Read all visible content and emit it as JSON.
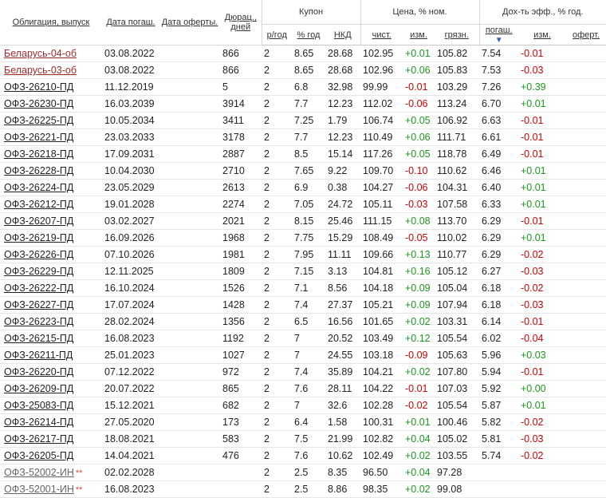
{
  "headers": {
    "bond": "Облигация, выпуск",
    "maturity_date": "Дата погаш.",
    "offer_date": "Дата оферты.",
    "duration": "Дюрац., дней",
    "coupon_group": "Купон",
    "price_group": "Цена, % ном.",
    "yield_group": "Дох-ть эфф., % год.",
    "coupon_freq": "р/год",
    "coupon_pct": "% год",
    "nkd": "НКД",
    "clean": "чист.",
    "change": "изм.",
    "dirty": "грязн.",
    "yield_maturity": "погаш.",
    "yield_change": "изм.",
    "yield_offer": "оферт."
  },
  "rows": [
    {
      "name": "Беларусь-04-об",
      "style": "red",
      "stars": "",
      "mat": "03.08.2022",
      "offer": "",
      "dur": "866",
      "freq": "2",
      "cpn": "8.65",
      "nkd": "28.68",
      "clean": "102.95",
      "chg": "+0.01",
      "dirty": "105.82",
      "ym": "7.54",
      "ychg": "-0.01",
      "yoff": ""
    },
    {
      "name": "Беларусь-03-об",
      "style": "red",
      "stars": "",
      "mat": "03.08.2022",
      "offer": "",
      "dur": "866",
      "freq": "2",
      "cpn": "8.65",
      "nkd": "28.68",
      "clean": "102.96",
      "chg": "+0.06",
      "dirty": "105.83",
      "ym": "7.53",
      "ychg": "-0.03",
      "yoff": ""
    },
    {
      "name": "ОФЗ-26210-ПД",
      "style": "",
      "stars": "",
      "mat": "11.12.2019",
      "offer": "",
      "dur": "5",
      "freq": "2",
      "cpn": "6.8",
      "nkd": "32.98",
      "clean": "99.99",
      "chg": "-0.01",
      "dirty": "103.29",
      "ym": "7.26",
      "ychg": "+0.39",
      "yoff": ""
    },
    {
      "name": "ОФЗ-26230-ПД",
      "style": "",
      "stars": "",
      "mat": "16.03.2039",
      "offer": "",
      "dur": "3914",
      "freq": "2",
      "cpn": "7.7",
      "nkd": "12.23",
      "clean": "112.02",
      "chg": "-0.06",
      "dirty": "113.24",
      "ym": "6.70",
      "ychg": "+0.01",
      "yoff": ""
    },
    {
      "name": "ОФЗ-26225-ПД",
      "style": "",
      "stars": "",
      "mat": "10.05.2034",
      "offer": "",
      "dur": "3411",
      "freq": "2",
      "cpn": "7.25",
      "nkd": "1.79",
      "clean": "106.74",
      "chg": "+0.05",
      "dirty": "106.92",
      "ym": "6.63",
      "ychg": "-0.01",
      "yoff": ""
    },
    {
      "name": "ОФЗ-26221-ПД",
      "style": "",
      "stars": "",
      "mat": "23.03.2033",
      "offer": "",
      "dur": "3178",
      "freq": "2",
      "cpn": "7.7",
      "nkd": "12.23",
      "clean": "110.49",
      "chg": "+0.06",
      "dirty": "111.71",
      "ym": "6.61",
      "ychg": "-0.01",
      "yoff": ""
    },
    {
      "name": "ОФЗ-26218-ПД",
      "style": "",
      "stars": "",
      "mat": "17.09.2031",
      "offer": "",
      "dur": "2887",
      "freq": "2",
      "cpn": "8.5",
      "nkd": "15.14",
      "clean": "117.26",
      "chg": "+0.05",
      "dirty": "118.78",
      "ym": "6.49",
      "ychg": "-0.01",
      "yoff": ""
    },
    {
      "name": "ОФЗ-26228-ПД",
      "style": "",
      "stars": "",
      "mat": "10.04.2030",
      "offer": "",
      "dur": "2710",
      "freq": "2",
      "cpn": "7.65",
      "nkd": "9.22",
      "clean": "109.70",
      "chg": "-0.10",
      "dirty": "110.62",
      "ym": "6.46",
      "ychg": "+0.01",
      "yoff": ""
    },
    {
      "name": "ОФЗ-26224-ПД",
      "style": "",
      "stars": "",
      "mat": "23.05.2029",
      "offer": "",
      "dur": "2613",
      "freq": "2",
      "cpn": "6.9",
      "nkd": "0.38",
      "clean": "104.27",
      "chg": "-0.06",
      "dirty": "104.31",
      "ym": "6.40",
      "ychg": "+0.01",
      "yoff": ""
    },
    {
      "name": "ОФЗ-26212-ПД",
      "style": "",
      "stars": "",
      "mat": "19.01.2028",
      "offer": "",
      "dur": "2274",
      "freq": "2",
      "cpn": "7.05",
      "nkd": "24.72",
      "clean": "105.11",
      "chg": "-0.03",
      "dirty": "107.58",
      "ym": "6.33",
      "ychg": "+0.01",
      "yoff": ""
    },
    {
      "name": "ОФЗ-26207-ПД",
      "style": "",
      "stars": "",
      "mat": "03.02.2027",
      "offer": "",
      "dur": "2021",
      "freq": "2",
      "cpn": "8.15",
      "nkd": "25.46",
      "clean": "111.15",
      "chg": "+0.08",
      "dirty": "113.70",
      "ym": "6.29",
      "ychg": "-0.01",
      "yoff": ""
    },
    {
      "name": "ОФЗ-26219-ПД",
      "style": "",
      "stars": "",
      "mat": "16.09.2026",
      "offer": "",
      "dur": "1968",
      "freq": "2",
      "cpn": "7.75",
      "nkd": "15.29",
      "clean": "108.49",
      "chg": "-0.05",
      "dirty": "110.02",
      "ym": "6.29",
      "ychg": "+0.01",
      "yoff": ""
    },
    {
      "name": "ОФЗ-26226-ПД",
      "style": "",
      "stars": "",
      "mat": "07.10.2026",
      "offer": "",
      "dur": "1981",
      "freq": "2",
      "cpn": "7.95",
      "nkd": "11.11",
      "clean": "109.66",
      "chg": "+0.13",
      "dirty": "110.77",
      "ym": "6.29",
      "ychg": "-0.02",
      "yoff": ""
    },
    {
      "name": "ОФЗ-26229-ПД",
      "style": "",
      "stars": "",
      "mat": "12.11.2025",
      "offer": "",
      "dur": "1809",
      "freq": "2",
      "cpn": "7.15",
      "nkd": "3.13",
      "clean": "104.81",
      "chg": "+0.16",
      "dirty": "105.12",
      "ym": "6.27",
      "ychg": "-0.03",
      "yoff": ""
    },
    {
      "name": "ОФЗ-26222-ПД",
      "style": "",
      "stars": "",
      "mat": "16.10.2024",
      "offer": "",
      "dur": "1526",
      "freq": "2",
      "cpn": "7.1",
      "nkd": "8.56",
      "clean": "104.18",
      "chg": "+0.09",
      "dirty": "105.04",
      "ym": "6.18",
      "ychg": "-0.02",
      "yoff": ""
    },
    {
      "name": "ОФЗ-26227-ПД",
      "style": "",
      "stars": "",
      "mat": "17.07.2024",
      "offer": "",
      "dur": "1428",
      "freq": "2",
      "cpn": "7.4",
      "nkd": "27.37",
      "clean": "105.21",
      "chg": "+0.09",
      "dirty": "107.94",
      "ym": "6.18",
      "ychg": "-0.03",
      "yoff": ""
    },
    {
      "name": "ОФЗ-26223-ПД",
      "style": "",
      "stars": "",
      "mat": "28.02.2024",
      "offer": "",
      "dur": "1356",
      "freq": "2",
      "cpn": "6.5",
      "nkd": "16.56",
      "clean": "101.65",
      "chg": "+0.02",
      "dirty": "103.31",
      "ym": "6.14",
      "ychg": "-0.01",
      "yoff": ""
    },
    {
      "name": "ОФЗ-26215-ПД",
      "style": "",
      "stars": "",
      "mat": "16.08.2023",
      "offer": "",
      "dur": "1192",
      "freq": "2",
      "cpn": "7",
      "nkd": "20.52",
      "clean": "103.49",
      "chg": "+0.12",
      "dirty": "105.54",
      "ym": "6.02",
      "ychg": "-0.04",
      "yoff": ""
    },
    {
      "name": "ОФЗ-26211-ПД",
      "style": "",
      "stars": "",
      "mat": "25.01.2023",
      "offer": "",
      "dur": "1027",
      "freq": "2",
      "cpn": "7",
      "nkd": "24.55",
      "clean": "103.18",
      "chg": "-0.09",
      "dirty": "105.63",
      "ym": "5.96",
      "ychg": "+0.03",
      "yoff": ""
    },
    {
      "name": "ОФЗ-26220-ПД",
      "style": "",
      "stars": "",
      "mat": "07.12.2022",
      "offer": "",
      "dur": "972",
      "freq": "2",
      "cpn": "7.4",
      "nkd": "35.89",
      "clean": "104.21",
      "chg": "+0.02",
      "dirty": "107.80",
      "ym": "5.94",
      "ychg": "-0.01",
      "yoff": ""
    },
    {
      "name": "ОФЗ-26209-ПД",
      "style": "",
      "stars": "",
      "mat": "20.07.2022",
      "offer": "",
      "dur": "865",
      "freq": "2",
      "cpn": "7.6",
      "nkd": "28.11",
      "clean": "104.22",
      "chg": "-0.01",
      "dirty": "107.03",
      "ym": "5.92",
      "ychg": "+0.00",
      "yoff": ""
    },
    {
      "name": "ОФЗ-25083-ПД",
      "style": "",
      "stars": "",
      "mat": "15.12.2021",
      "offer": "",
      "dur": "682",
      "freq": "2",
      "cpn": "7",
      "nkd": "32.6",
      "clean": "102.28",
      "chg": "-0.02",
      "dirty": "105.54",
      "ym": "5.87",
      "ychg": "+0.01",
      "yoff": ""
    },
    {
      "name": "ОФЗ-26214-ПД",
      "style": "",
      "stars": "",
      "mat": "27.05.2020",
      "offer": "",
      "dur": "173",
      "freq": "2",
      "cpn": "6.4",
      "nkd": "1.58",
      "clean": "100.31",
      "chg": "+0.01",
      "dirty": "100.46",
      "ym": "5.82",
      "ychg": "-0.02",
      "yoff": ""
    },
    {
      "name": "ОФЗ-26217-ПД",
      "style": "",
      "stars": "",
      "mat": "18.08.2021",
      "offer": "",
      "dur": "583",
      "freq": "2",
      "cpn": "7.5",
      "nkd": "21.99",
      "clean": "102.82",
      "chg": "+0.04",
      "dirty": "105.02",
      "ym": "5.81",
      "ychg": "-0.03",
      "yoff": ""
    },
    {
      "name": "ОФЗ-26205-ПД",
      "style": "",
      "stars": "",
      "mat": "14.04.2021",
      "offer": "",
      "dur": "476",
      "freq": "2",
      "cpn": "7.6",
      "nkd": "10.62",
      "clean": "102.49",
      "chg": "+0.02",
      "dirty": "103.55",
      "ym": "5.74",
      "ychg": "-0.02",
      "yoff": ""
    },
    {
      "name": "ОФЗ-52002-ИН",
      "style": "gray",
      "stars": "**",
      "mat": "02.02.2028",
      "offer": "",
      "dur": "",
      "freq": "2",
      "cpn": "2.5",
      "nkd": "8.35",
      "clean": "96.50",
      "chg": "+0.04",
      "dirty": "97.28",
      "ym": "",
      "ychg": "",
      "yoff": ""
    },
    {
      "name": "ОФЗ-52001-ИН",
      "style": "gray",
      "stars": "**",
      "mat": "16.08.2023",
      "offer": "",
      "dur": "",
      "freq": "2",
      "cpn": "2.5",
      "nkd": "8.86",
      "clean": "98.35",
      "chg": "+0.02",
      "dirty": "99.08",
      "ym": "",
      "ychg": "",
      "yoff": ""
    }
  ]
}
